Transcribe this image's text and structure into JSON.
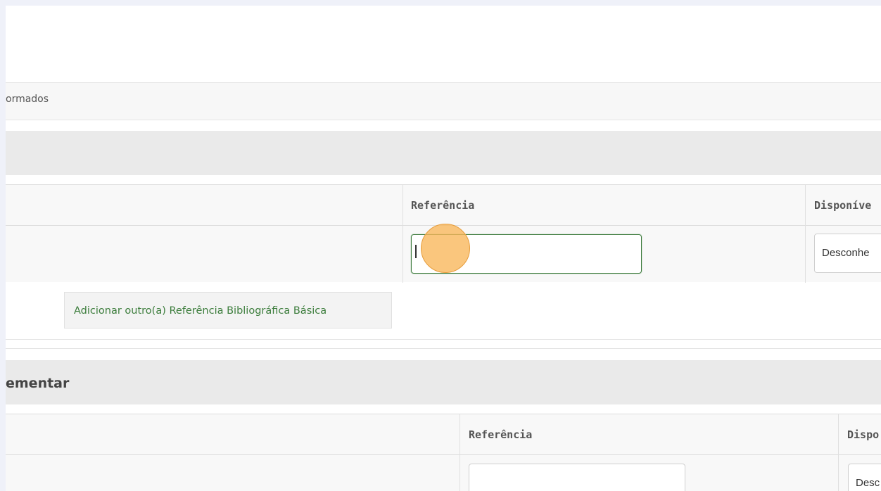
{
  "info": {
    "text": "ormados"
  },
  "section_basic": {
    "title": "",
    "table": {
      "headers": {
        "referencia": "Referência",
        "disponivel": "Disponíve"
      },
      "row": {
        "referencia_value": "",
        "disponivel_value": "Desconhe"
      }
    },
    "add_button_label": "Adicionar outro(a) Referência Bibliográfica Básica"
  },
  "section_complementar": {
    "title": "ementar",
    "table": {
      "headers": {
        "referencia": "Referência",
        "disponivel": "Dispo"
      },
      "row": {
        "referencia_value": "",
        "disponivel_value": "Desc"
      }
    }
  },
  "colors": {
    "accent_green": "#3c7d3c",
    "click_marker": "#f8b658"
  }
}
